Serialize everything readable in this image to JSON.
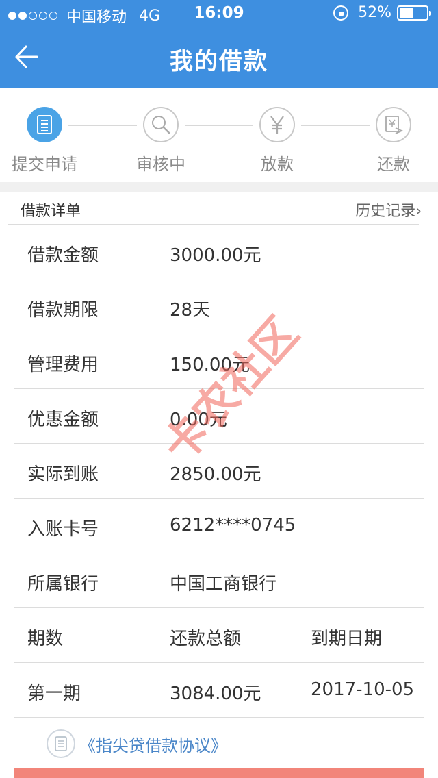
{
  "statusbar": {
    "carrier": "中国移动",
    "network": "4G",
    "time": "16:09",
    "battery": "52%",
    "battery_level": 0.52
  },
  "navbar": {
    "title": "我的借款"
  },
  "steps": [
    {
      "label": "提交申请",
      "icon": "document-icon",
      "active": true
    },
    {
      "label": "审核中",
      "icon": "search-icon",
      "active": false
    },
    {
      "label": "放款",
      "icon": "yen-icon",
      "active": false
    },
    {
      "label": "还款",
      "icon": "receipt-icon",
      "active": false
    }
  ],
  "details": {
    "title": "借款详单",
    "history": "历史记录",
    "rows": [
      {
        "key": "借款金额",
        "value": "3000.00元"
      },
      {
        "key": "借款期限",
        "value": "28天"
      },
      {
        "key": "管理费用",
        "value": "150.00元"
      },
      {
        "key": "优惠金额",
        "value": "0.00元"
      },
      {
        "key": "实际到账",
        "value": "2850.00元"
      },
      {
        "key": "入账卡号",
        "value": "6212****0745"
      },
      {
        "key": "所属银行",
        "value": "中国工商银行"
      }
    ],
    "schedule_headers": [
      "期数",
      "还款总额",
      "到期日期"
    ],
    "schedule_rows": [
      [
        "第一期",
        "3084.00元",
        "2017-10-05"
      ]
    ]
  },
  "agreement": {
    "label": "《指尖贷借款协议》"
  },
  "watermark": "卡农社区",
  "colors": {
    "primary": "#3e8fe0",
    "step_active": "#4aa3e6",
    "link": "#4a86c8",
    "bottom_button": "#f2857a"
  }
}
